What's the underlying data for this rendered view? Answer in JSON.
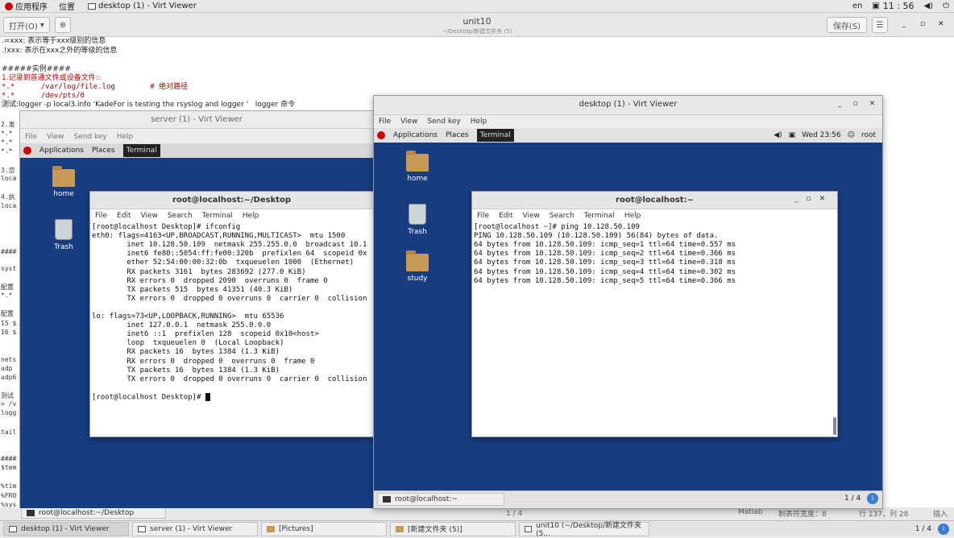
{
  "topbar": {
    "apps": "应用程序",
    "places": "位置",
    "task": "desktop (1) - Virt Viewer",
    "lang": "en",
    "clock": "11 : 56"
  },
  "gedit": {
    "open": "打开(O)",
    "title": "unit10",
    "subtitle": "~/Desktop/新建文件夹 (5)",
    "save": "保存(S)",
    "lines": [
      ".=xxx: 表示等于xxx级别的信息",
      ".!xxx: 表示在xxx之外的等级的信息",
      "",
      "#####实例####",
      "1.记录到普通文件或设备文件::",
      "*.*      /var/log/file.log        # 绝对路径",
      "*.*      /dev/pts/0",
      "测试:logger -p local3.info 'KadeFor is testing the rsyslog and logger '   logger 命令"
    ],
    "frags": [
      "2.发",
      "*.*",
      "*.*",
      "*.*",
      "3.忽",
      "loca",
      "4.执",
      "loca",
      "####",
      "syst",
      "配置",
      "*.*",
      "配置",
      "15 $",
      "16 $",
      "nets",
      "udp",
      "udp6",
      "测试",
      "> /v",
      "logg",
      "tail",
      "####",
      "$tem",
      "%tim",
      "%FRO",
      "%sys"
    ],
    "status_lang": "Matlab",
    "status_tab": "制表符宽度：8",
    "status_pos": "行 137，列 28",
    "status_ins": "插入",
    "status_page": "1 / 4"
  },
  "server": {
    "title": "server (1) - Virt Viewer",
    "menu": [
      "File",
      "View",
      "Send key",
      "Help"
    ],
    "apps": "Applications",
    "places": "Places",
    "terminal": "Terminal",
    "icons": [
      "home",
      "Trash"
    ],
    "term_title": "root@localhost:~/Desktop",
    "term_menu": [
      "File",
      "Edit",
      "View",
      "Search",
      "Terminal",
      "Help"
    ],
    "lines": [
      "[root@localhost Desktop]# ifconfig",
      "eth0: flags=4163<UP,BROADCAST,RUNNING,MULTICAST>  mtu 1500",
      "        inet 10.128.50.109  netmask 255.255.0.0  broadcast 10.1",
      "        inet6 fe80::5054:ff:fe00:320b  prefixlen 64  scopeid 0x",
      "        ether 52:54:00:00:32:0b  txqueuelen 1000  (Ethernet)",
      "        RX packets 3161  bytes 283692 (277.0 KiB)",
      "        RX errors 0  dropped 2090  overruns 0  frame 0",
      "        TX packets 515  bytes 41351 (40.3 KiB)",
      "        TX errors 0  dropped 0 overruns 0  carrier 0  collision",
      "",
      "lo: flags=73<UP,LOOPBACK,RUNNING>  mtu 65536",
      "        inet 127.0.0.1  netmask 255.0.0.0",
      "        inet6 ::1  prefixlen 128  scopeid 0x10<host>",
      "        loop  txqueuelen 0  (Local Loopback)",
      "        RX packets 16  bytes 1384 (1.3 KiB)",
      "        RX errors 0  dropped 0  overruns 0  frame 0",
      "        TX packets 16  bytes 1384 (1.3 KiB)",
      "        TX errors 0  dropped 0 overruns 0  carrier 0  collision",
      "",
      "[root@localhost Desktop]# "
    ],
    "bottom_task": "root@localhost:~/Desktop",
    "page": "1 / 4"
  },
  "desktop": {
    "title": "desktop (1) - Virt Viewer",
    "menu": [
      "File",
      "View",
      "Send key",
      "Help"
    ],
    "apps": "Applications",
    "places": "Places",
    "terminal": "Terminal",
    "time": "Wed 23:56",
    "user": "root",
    "icons": [
      "home",
      "Trash",
      "study"
    ],
    "term_title": "root@localhost:~",
    "term_menu": [
      "File",
      "Edit",
      "View",
      "Search",
      "Terminal",
      "Help"
    ],
    "lines": [
      "[root@localhost ~]# ping 10.128.50.109",
      "PING 10.128.50.109 (10.128.50.109) 56(84) bytes of data.",
      "64 bytes from 10.128.50.109: icmp_seq=1 ttl=64 time=0.557 ms",
      "64 bytes from 10.128.50.109: icmp_seq=2 ttl=64 time=0.366 ms",
      "64 bytes from 10.128.50.109: icmp_seq=3 ttl=64 time=0.318 ms",
      "64 bytes from 10.128.50.109: icmp_seq=4 ttl=64 time=0.302 ms",
      "64 bytes from 10.128.50.109: icmp_seq=5 ttl=64 time=0.366 ms"
    ],
    "bottom_task": "root@localhost:~",
    "page": "1 / 4"
  },
  "taskbar": {
    "items": [
      "desktop (1) - Virt Viewer",
      "server (1) - Virt Viewer",
      "[Pictures]",
      "[新建文件夹 (5)]",
      "unit10 (~/Desktop/新建文件夹 (5..."
    ],
    "page": "1 / 4"
  }
}
